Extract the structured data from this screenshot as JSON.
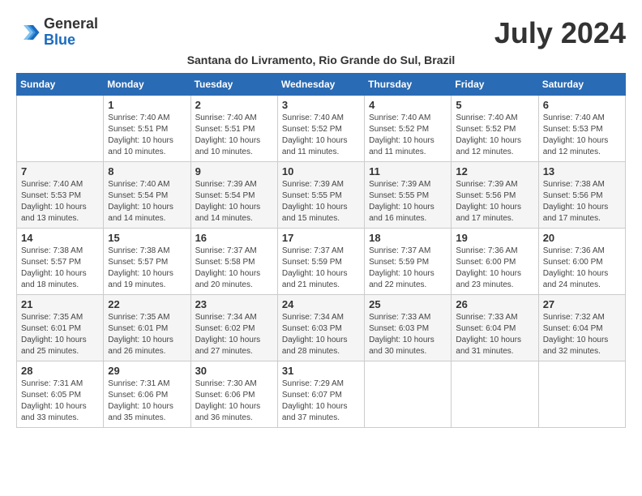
{
  "logo": {
    "general": "General",
    "blue": "Blue"
  },
  "title": "July 2024",
  "subtitle": "Santana do Livramento, Rio Grande do Sul, Brazil",
  "headers": [
    "Sunday",
    "Monday",
    "Tuesday",
    "Wednesday",
    "Thursday",
    "Friday",
    "Saturday"
  ],
  "weeks": [
    [
      {
        "day": "",
        "info": ""
      },
      {
        "day": "1",
        "info": "Sunrise: 7:40 AM\nSunset: 5:51 PM\nDaylight: 10 hours\nand 10 minutes."
      },
      {
        "day": "2",
        "info": "Sunrise: 7:40 AM\nSunset: 5:51 PM\nDaylight: 10 hours\nand 10 minutes."
      },
      {
        "day": "3",
        "info": "Sunrise: 7:40 AM\nSunset: 5:52 PM\nDaylight: 10 hours\nand 11 minutes."
      },
      {
        "day": "4",
        "info": "Sunrise: 7:40 AM\nSunset: 5:52 PM\nDaylight: 10 hours\nand 11 minutes."
      },
      {
        "day": "5",
        "info": "Sunrise: 7:40 AM\nSunset: 5:52 PM\nDaylight: 10 hours\nand 12 minutes."
      },
      {
        "day": "6",
        "info": "Sunrise: 7:40 AM\nSunset: 5:53 PM\nDaylight: 10 hours\nand 12 minutes."
      }
    ],
    [
      {
        "day": "7",
        "info": "Sunrise: 7:40 AM\nSunset: 5:53 PM\nDaylight: 10 hours\nand 13 minutes."
      },
      {
        "day": "8",
        "info": "Sunrise: 7:40 AM\nSunset: 5:54 PM\nDaylight: 10 hours\nand 14 minutes."
      },
      {
        "day": "9",
        "info": "Sunrise: 7:39 AM\nSunset: 5:54 PM\nDaylight: 10 hours\nand 14 minutes."
      },
      {
        "day": "10",
        "info": "Sunrise: 7:39 AM\nSunset: 5:55 PM\nDaylight: 10 hours\nand 15 minutes."
      },
      {
        "day": "11",
        "info": "Sunrise: 7:39 AM\nSunset: 5:55 PM\nDaylight: 10 hours\nand 16 minutes."
      },
      {
        "day": "12",
        "info": "Sunrise: 7:39 AM\nSunset: 5:56 PM\nDaylight: 10 hours\nand 17 minutes."
      },
      {
        "day": "13",
        "info": "Sunrise: 7:38 AM\nSunset: 5:56 PM\nDaylight: 10 hours\nand 17 minutes."
      }
    ],
    [
      {
        "day": "14",
        "info": "Sunrise: 7:38 AM\nSunset: 5:57 PM\nDaylight: 10 hours\nand 18 minutes."
      },
      {
        "day": "15",
        "info": "Sunrise: 7:38 AM\nSunset: 5:57 PM\nDaylight: 10 hours\nand 19 minutes."
      },
      {
        "day": "16",
        "info": "Sunrise: 7:37 AM\nSunset: 5:58 PM\nDaylight: 10 hours\nand 20 minutes."
      },
      {
        "day": "17",
        "info": "Sunrise: 7:37 AM\nSunset: 5:59 PM\nDaylight: 10 hours\nand 21 minutes."
      },
      {
        "day": "18",
        "info": "Sunrise: 7:37 AM\nSunset: 5:59 PM\nDaylight: 10 hours\nand 22 minutes."
      },
      {
        "day": "19",
        "info": "Sunrise: 7:36 AM\nSunset: 6:00 PM\nDaylight: 10 hours\nand 23 minutes."
      },
      {
        "day": "20",
        "info": "Sunrise: 7:36 AM\nSunset: 6:00 PM\nDaylight: 10 hours\nand 24 minutes."
      }
    ],
    [
      {
        "day": "21",
        "info": "Sunrise: 7:35 AM\nSunset: 6:01 PM\nDaylight: 10 hours\nand 25 minutes."
      },
      {
        "day": "22",
        "info": "Sunrise: 7:35 AM\nSunset: 6:01 PM\nDaylight: 10 hours\nand 26 minutes."
      },
      {
        "day": "23",
        "info": "Sunrise: 7:34 AM\nSunset: 6:02 PM\nDaylight: 10 hours\nand 27 minutes."
      },
      {
        "day": "24",
        "info": "Sunrise: 7:34 AM\nSunset: 6:03 PM\nDaylight: 10 hours\nand 28 minutes."
      },
      {
        "day": "25",
        "info": "Sunrise: 7:33 AM\nSunset: 6:03 PM\nDaylight: 10 hours\nand 30 minutes."
      },
      {
        "day": "26",
        "info": "Sunrise: 7:33 AM\nSunset: 6:04 PM\nDaylight: 10 hours\nand 31 minutes."
      },
      {
        "day": "27",
        "info": "Sunrise: 7:32 AM\nSunset: 6:04 PM\nDaylight: 10 hours\nand 32 minutes."
      }
    ],
    [
      {
        "day": "28",
        "info": "Sunrise: 7:31 AM\nSunset: 6:05 PM\nDaylight: 10 hours\nand 33 minutes."
      },
      {
        "day": "29",
        "info": "Sunrise: 7:31 AM\nSunset: 6:06 PM\nDaylight: 10 hours\nand 35 minutes."
      },
      {
        "day": "30",
        "info": "Sunrise: 7:30 AM\nSunset: 6:06 PM\nDaylight: 10 hours\nand 36 minutes."
      },
      {
        "day": "31",
        "info": "Sunrise: 7:29 AM\nSunset: 6:07 PM\nDaylight: 10 hours\nand 37 minutes."
      },
      {
        "day": "",
        "info": ""
      },
      {
        "day": "",
        "info": ""
      },
      {
        "day": "",
        "info": ""
      }
    ]
  ]
}
